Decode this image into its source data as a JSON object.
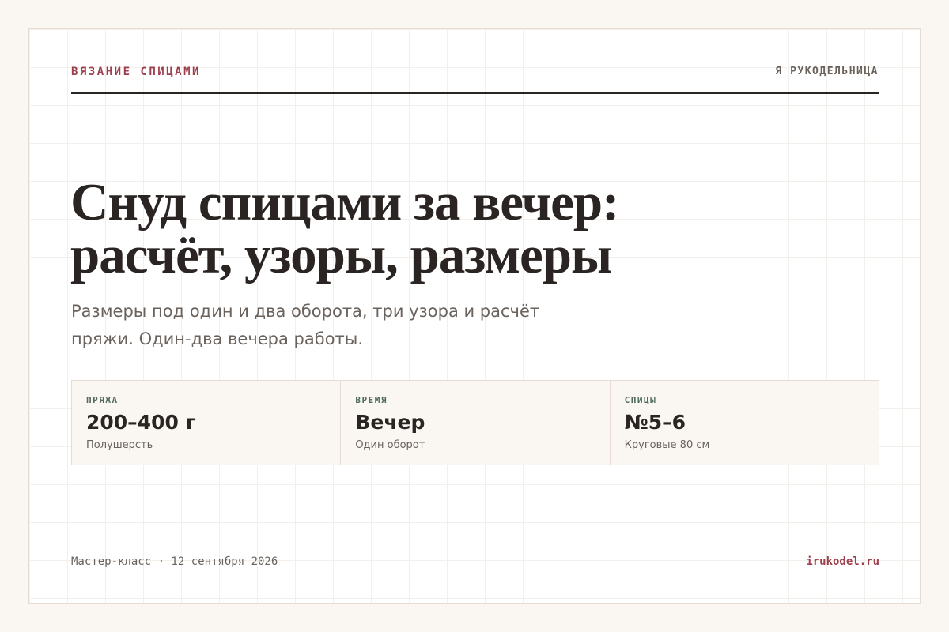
{
  "header": {
    "section_label": "ВЯЗАНИЕ СПИЦАМИ",
    "brand": "Я РУКОДЕЛЬНИЦА"
  },
  "hero": {
    "title_line1": "Снуд спицами за вечер:",
    "title_line2": "расчёт, узоры, размеры",
    "subtitle": "Размеры под один и два оборота, три узора и расчёт пряжи. Один-два вечера работы."
  },
  "stats": [
    {
      "label": "ПРЯЖА",
      "value": "200–400 г",
      "note": "Полушерсть"
    },
    {
      "label": "ВРЕМЯ",
      "value": "Вечер",
      "note": "Один оборот"
    },
    {
      "label": "СПИЦЫ",
      "value": "№5–6",
      "note": "Круговые 80 см"
    }
  ],
  "footer": {
    "meta": "Мастер-класс · 12 сентября 2026",
    "site": "irukodel.ru"
  },
  "colors": {
    "accent": "#9e3f4e",
    "label_green": "#4f6b59",
    "text": "#2a2522",
    "muted": "#6a625c"
  }
}
